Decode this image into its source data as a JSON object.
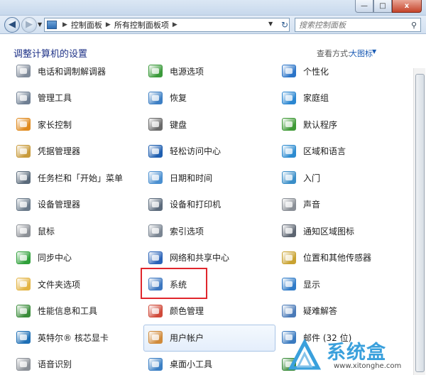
{
  "window": {
    "caption_buttons": [
      "minimize",
      "maximize",
      "close"
    ],
    "close_glyph": "x"
  },
  "nav": {
    "back_glyph": "◀",
    "forward_glyph": "▶",
    "breadcrumbs": [
      "控制面板",
      "所有控制面板项"
    ],
    "search_placeholder": "搜索控制面板"
  },
  "header": {
    "title": "调整计算机的设置",
    "view_by_label": "查看方式:",
    "view_by_value": "大图标"
  },
  "items": [
    {
      "label": "电话和调制解调器",
      "icon": "phone-modem-icon",
      "color": "#7f8a99"
    },
    {
      "label": "电源选项",
      "icon": "power-options-icon",
      "color": "#3b9a3b"
    },
    {
      "label": "个性化",
      "icon": "personalization-icon",
      "color": "#2b74c8"
    },
    {
      "label": "管理工具",
      "icon": "admin-tools-icon",
      "color": "#6f7f93"
    },
    {
      "label": "恢复",
      "icon": "recovery-icon",
      "color": "#3d7fc4"
    },
    {
      "label": "家庭组",
      "icon": "homegroup-icon",
      "color": "#2a86d1"
    },
    {
      "label": "家长控制",
      "icon": "parental-controls-icon",
      "color": "#e08a1e"
    },
    {
      "label": "键盘",
      "icon": "keyboard-icon",
      "color": "#6a6a6a"
    },
    {
      "label": "默认程序",
      "icon": "default-programs-icon",
      "color": "#3f9a36"
    },
    {
      "label": "凭据管理器",
      "icon": "credential-manager-icon",
      "color": "#c89a3a"
    },
    {
      "label": "轻松访问中心",
      "icon": "ease-of-access-icon",
      "color": "#1f5fb0"
    },
    {
      "label": "区域和语言",
      "icon": "region-language-icon",
      "color": "#2c8bd0"
    },
    {
      "label": "任务栏和「开始」菜单",
      "icon": "taskbar-icon",
      "color": "#5a6a7a"
    },
    {
      "label": "日期和时间",
      "icon": "date-time-icon",
      "color": "#4a8fd0"
    },
    {
      "label": "入门",
      "icon": "getting-started-icon",
      "color": "#3a8ec8"
    },
    {
      "label": "设备管理器",
      "icon": "device-manager-icon",
      "color": "#6a7a8a"
    },
    {
      "label": "设备和打印机",
      "icon": "devices-printers-icon",
      "color": "#5c6b7c"
    },
    {
      "label": "声音",
      "icon": "sound-icon",
      "color": "#8a8f96"
    },
    {
      "label": "鼠标",
      "icon": "mouse-icon",
      "color": "#8c9096"
    },
    {
      "label": "索引选项",
      "icon": "indexing-options-icon",
      "color": "#7a8592"
    },
    {
      "label": "通知区域图标",
      "icon": "notification-area-icon",
      "color": "#5c6470"
    },
    {
      "label": "同步中心",
      "icon": "sync-center-icon",
      "color": "#2fa03a"
    },
    {
      "label": "网络和共享中心",
      "icon": "network-sharing-icon",
      "color": "#2a63b8"
    },
    {
      "label": "位置和其他传感器",
      "icon": "location-sensors-icon",
      "color": "#c9a230"
    },
    {
      "label": "文件夹选项",
      "icon": "folder-options-icon",
      "color": "#e3b341"
    },
    {
      "label": "系统",
      "icon": "system-icon",
      "color": "#3c77c0"
    },
    {
      "label": "显示",
      "icon": "display-icon",
      "color": "#2f7bc8"
    },
    {
      "label": "性能信息和工具",
      "icon": "performance-icon",
      "color": "#3a8c3a"
    },
    {
      "label": "颜色管理",
      "icon": "color-management-icon",
      "color": "#d04a3a"
    },
    {
      "label": "疑难解答",
      "icon": "troubleshooting-icon",
      "color": "#4a7ab8"
    },
    {
      "label": "英特尔® 核芯显卡",
      "icon": "intel-graphics-icon",
      "color": "#1e6fb5"
    },
    {
      "label": "用户帐户",
      "icon": "user-accounts-icon",
      "color": "#d08a3a"
    },
    {
      "label": "邮件 (32 位)",
      "icon": "mail-icon",
      "color": "#3a7ac0"
    },
    {
      "label": "语音识别",
      "icon": "speech-recognition-icon",
      "color": "#8a8f96"
    },
    {
      "label": "桌面小工具",
      "icon": "desktop-gadgets-icon",
      "color": "#3b7fc4"
    },
    {
      "label": "",
      "icon": "windows-update-icon",
      "color": "#3a8c3a"
    }
  ],
  "watermark": {
    "text": "系统盒",
    "url": "www.xitonghe.com",
    "accent": "#3aa0dc"
  }
}
